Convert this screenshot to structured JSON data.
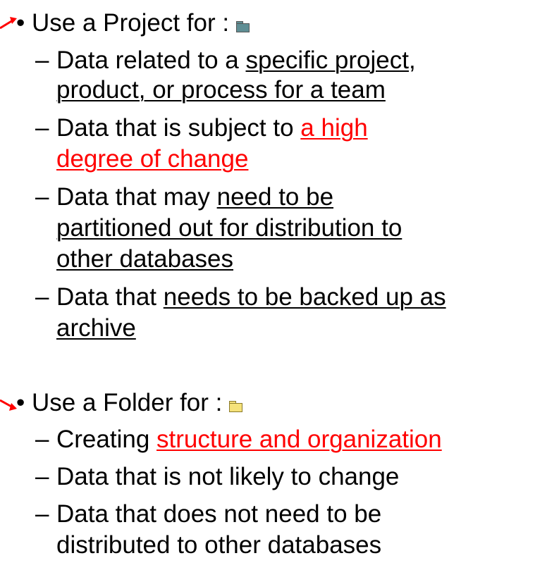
{
  "project_section": {
    "heading": "Use a Project for :",
    "icon": "project-icon",
    "items": {
      "item1": {
        "prefix": "Data related to a ",
        "link1": "specific project",
        "mid": ",",
        "link2": "product, or process for a team"
      },
      "item2": {
        "prefix": "Data that is subject to ",
        "link1": "a high",
        "link2": "degree of change"
      },
      "item3": {
        "prefix": "Data that may ",
        "link1": "need to be",
        "link2": "partitioned out for distribution to",
        "link3": "other databases"
      },
      "item4": {
        "prefix": "Data that ",
        "link1": "needs to be backed up as",
        "link2": "archive"
      }
    }
  },
  "folder_section": {
    "heading": "Use a Folder for :",
    "icon": "folder-icon",
    "items": {
      "item1": {
        "prefix": "Creating ",
        "link1": "structure and organization"
      },
      "item2": {
        "text": "Data that is not likely to change"
      },
      "item3": {
        "line1": "Data that does not need to be",
        "line2": "distributed to other databases"
      }
    }
  },
  "colors": {
    "text": "#000000",
    "highlight": "#ff0000",
    "project_icon": "#5f8e94",
    "folder_icon": "#f5e27a"
  }
}
